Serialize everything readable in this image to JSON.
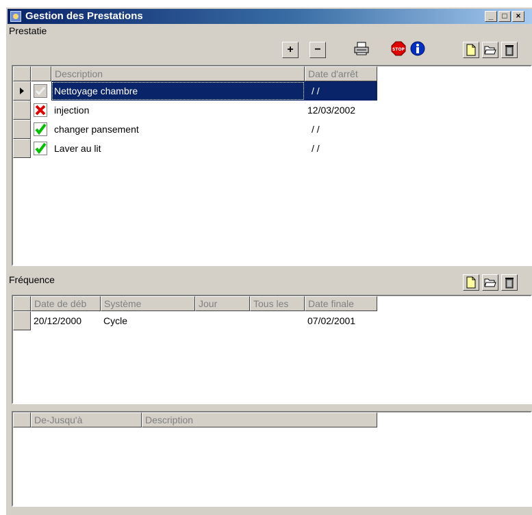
{
  "window": {
    "title": "Gestion des Prestations"
  },
  "prestatie": {
    "label": "Prestatie",
    "columns": [
      "Description",
      "Date d'arrêt"
    ],
    "rows": [
      {
        "status": "checked-disabled-icon",
        "description": "Nettoyage chambre",
        "date": " / /"
      },
      {
        "status": "red-x-icon",
        "description": "injection",
        "date": "12/03/2002"
      },
      {
        "status": "green-check-icon",
        "description": "changer pansement",
        "date": " / /"
      },
      {
        "status": "green-check-icon",
        "description": "Laver au lit",
        "date": " / /"
      }
    ],
    "toolbar": {
      "add": "+",
      "remove": "−"
    }
  },
  "frequence": {
    "label": "Fréquence",
    "columns": [
      "Date de déb",
      "Système",
      "Jour",
      "Tous les",
      "Date finale"
    ],
    "rows": [
      {
        "start": "20/12/2000",
        "system": "Cycle",
        "day": "",
        "every": "",
        "end": "07/02/2001"
      }
    ]
  },
  "periods": {
    "columns": [
      "De-Jusqu'à",
      "Description"
    ]
  },
  "colors": {
    "title_start": "#0a246a",
    "selection": "#0a246a",
    "face": "#d4d0c8"
  }
}
